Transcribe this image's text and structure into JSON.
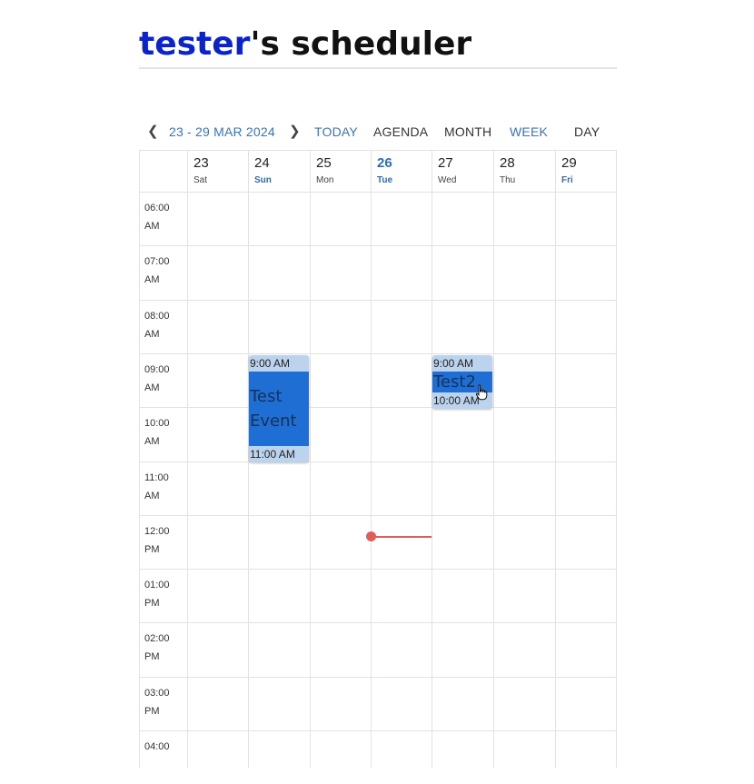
{
  "header": {
    "user": "tester",
    "suffix": "'s scheduler"
  },
  "toolbar": {
    "prev_icon": "chevron-left-icon",
    "range": "23 - 29 MAR 2024",
    "next_icon": "chevron-right-icon",
    "today": "TODAY",
    "views": [
      "AGENDA",
      "MONTH",
      "WEEK",
      "DAY"
    ],
    "active_view": "WEEK"
  },
  "days": [
    {
      "num": "23",
      "dow": "Sat"
    },
    {
      "num": "24",
      "dow": "Sun"
    },
    {
      "num": "25",
      "dow": "Mon"
    },
    {
      "num": "26",
      "dow": "Tue"
    },
    {
      "num": "27",
      "dow": "Wed"
    },
    {
      "num": "28",
      "dow": "Thu"
    },
    {
      "num": "29",
      "dow": "Fri"
    }
  ],
  "today_index": 3,
  "times": [
    {
      "h": "06:00",
      "p": "AM"
    },
    {
      "h": "07:00",
      "p": "AM"
    },
    {
      "h": "08:00",
      "p": "AM"
    },
    {
      "h": "09:00",
      "p": "AM"
    },
    {
      "h": "10:00",
      "p": "AM"
    },
    {
      "h": "11:00",
      "p": "AM"
    },
    {
      "h": "12:00",
      "p": "PM"
    },
    {
      "h": "01:00",
      "p": "PM"
    },
    {
      "h": "02:00",
      "p": "PM"
    },
    {
      "h": "03:00",
      "p": "PM"
    },
    {
      "h": "04:00",
      "p": ""
    }
  ],
  "events": [
    {
      "title_lines": [
        "Test",
        "Event"
      ],
      "start": "9:00 AM",
      "end": "11:00 AM",
      "day": "Sun"
    },
    {
      "title_lines": [
        "Test2"
      ],
      "start": "9:00 AM",
      "end": "10:00 AM",
      "day": "Wed"
    }
  ],
  "colors": {
    "username": "#0a23cc",
    "accent": "#3b74b9",
    "event_fill": "#1f6ed4",
    "event_band": "#bcd3ee",
    "now_indicator": "#e25b5b"
  },
  "current_time_indicator": {
    "day": "Tue"
  },
  "pointer_icon": "hand-pointer-icon"
}
